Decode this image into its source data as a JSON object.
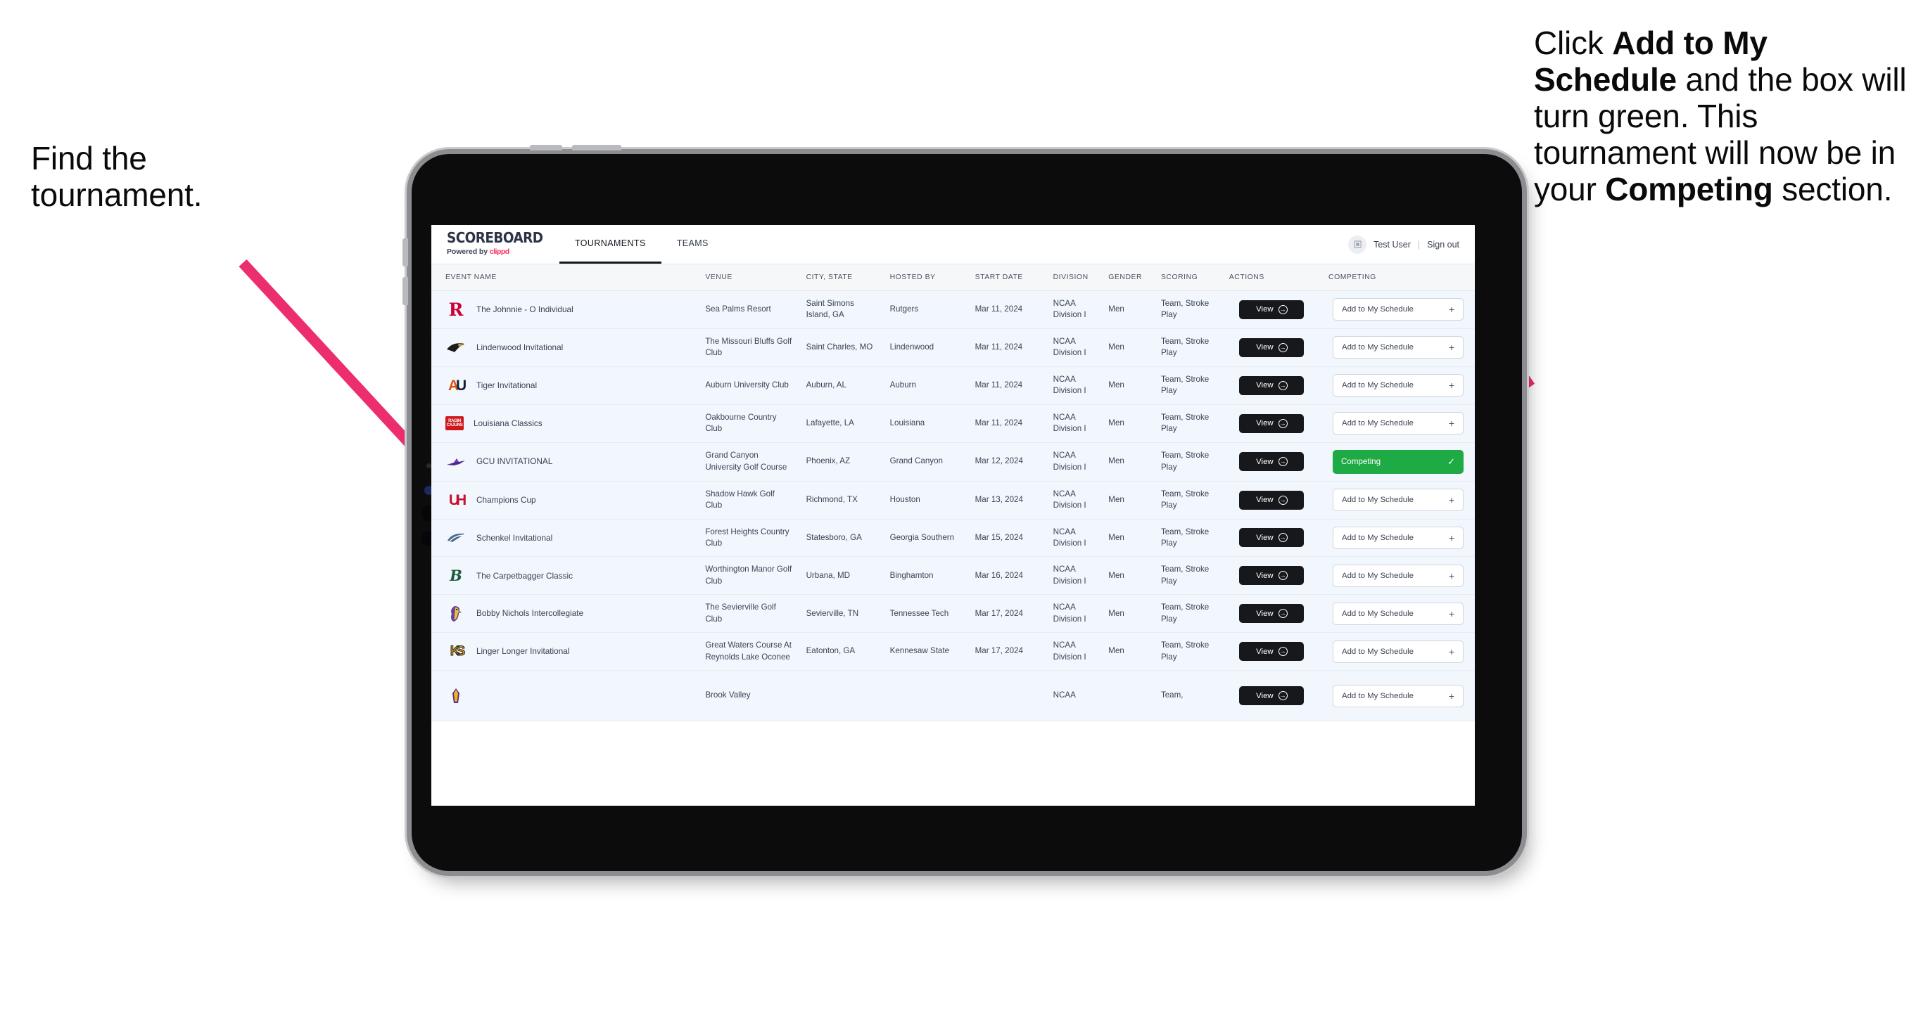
{
  "annotations": {
    "left": {
      "line1": "Find the",
      "line2": "tournament."
    },
    "right": {
      "part1": "Click ",
      "bold1": "Add to My Schedule",
      "part2": " and the box will turn green. This tournament will now be in your ",
      "bold2": "Competing",
      "part3": " section."
    },
    "arrow_color": "#ed2e6e"
  },
  "app": {
    "brand": {
      "title": "SCOREBOARD",
      "powered_prefix": "Powered by ",
      "powered_brand": "clippd"
    },
    "tabs": [
      {
        "label": "TOURNAMENTS",
        "active": true
      },
      {
        "label": "TEAMS",
        "active": false
      }
    ],
    "account": {
      "avatar_icon": "user-avatar-icon",
      "user": "Test User",
      "separator": "|",
      "sign_out": "Sign out"
    },
    "table": {
      "columns": [
        "EVENT NAME",
        "VENUE",
        "CITY, STATE",
        "HOSTED BY",
        "START DATE",
        "DIVISION",
        "GENDER",
        "SCORING",
        "ACTIONS",
        "COMPETING"
      ],
      "view_label": "View",
      "add_label": "Add to My Schedule",
      "add_plus": "+",
      "competing_label": "Competing",
      "competing_check": "✓",
      "competing_color": "#1eaa45",
      "rows": [
        {
          "logo": "rutgers-logo",
          "event": "The Johnnie - O Individual",
          "venue": "Sea Palms Resort",
          "city": "Saint Simons Island, GA",
          "host": "Rutgers",
          "date": "Mar 11, 2024",
          "division": "NCAA Division I",
          "gender": "Men",
          "scoring": "Team, Stroke Play",
          "competing": false
        },
        {
          "logo": "lindenwood-logo",
          "event": "Lindenwood Invitational",
          "venue": "The Missouri Bluffs Golf Club",
          "city": "Saint Charles, MO",
          "host": "Lindenwood",
          "date": "Mar 11, 2024",
          "division": "NCAA Division I",
          "gender": "Men",
          "scoring": "Team, Stroke Play",
          "competing": false
        },
        {
          "logo": "auburn-logo",
          "event": "Tiger Invitational",
          "venue": "Auburn University Club",
          "city": "Auburn, AL",
          "host": "Auburn",
          "date": "Mar 11, 2024",
          "division": "NCAA Division I",
          "gender": "Men",
          "scoring": "Team, Stroke Play",
          "competing": false
        },
        {
          "logo": "louisiana-logo",
          "event": "Louisiana Classics",
          "venue": "Oakbourne Country Club",
          "city": "Lafayette, LA",
          "host": "Louisiana",
          "date": "Mar 11, 2024",
          "division": "NCAA Division I",
          "gender": "Men",
          "scoring": "Team, Stroke Play",
          "competing": false
        },
        {
          "logo": "gcu-logo",
          "event": "GCU INVITATIONAL",
          "venue": "Grand Canyon University Golf Course",
          "city": "Phoenix, AZ",
          "host": "Grand Canyon",
          "date": "Mar 12, 2024",
          "division": "NCAA Division I",
          "gender": "Men",
          "scoring": "Team, Stroke Play",
          "competing": true
        },
        {
          "logo": "houston-logo",
          "event": "Champions Cup",
          "venue": "Shadow Hawk Golf Club",
          "city": "Richmond, TX",
          "host": "Houston",
          "date": "Mar 13, 2024",
          "division": "NCAA Division I",
          "gender": "Men",
          "scoring": "Team, Stroke Play",
          "competing": false
        },
        {
          "logo": "georgia-southern-logo",
          "event": "Schenkel Invitational",
          "venue": "Forest Heights Country Club",
          "city": "Statesboro, GA",
          "host": "Georgia Southern",
          "date": "Mar 15, 2024",
          "division": "NCAA Division I",
          "gender": "Men",
          "scoring": "Team, Stroke Play",
          "competing": false
        },
        {
          "logo": "binghamton-logo",
          "event": "The Carpetbagger Classic",
          "venue": "Worthington Manor Golf Club",
          "city": "Urbana, MD",
          "host": "Binghamton",
          "date": "Mar 16, 2024",
          "division": "NCAA Division I",
          "gender": "Men",
          "scoring": "Team, Stroke Play",
          "competing": false
        },
        {
          "logo": "tennessee-tech-logo",
          "event": "Bobby Nichols Intercollegiate",
          "venue": "The Sevierville Golf Club",
          "city": "Sevierville, TN",
          "host": "Tennessee Tech",
          "date": "Mar 17, 2024",
          "division": "NCAA Division I",
          "gender": "Men",
          "scoring": "Team, Stroke Play",
          "competing": false
        },
        {
          "logo": "kennesaw-logo",
          "event": "Linger Longer Invitational",
          "venue": "Great Waters Course At Reynolds Lake Oconee",
          "city": "Eatonton, GA",
          "host": "Kennesaw State",
          "date": "Mar 17, 2024",
          "division": "NCAA Division I",
          "gender": "Men",
          "scoring": "Team, Stroke Play",
          "competing": false
        },
        {
          "logo": "ecu-logo",
          "event": "",
          "venue": "Brook Valley",
          "city": "",
          "host": "",
          "date": "",
          "division": "NCAA",
          "gender": "",
          "scoring": "Team,",
          "competing": false,
          "clipped": true
        }
      ]
    }
  }
}
